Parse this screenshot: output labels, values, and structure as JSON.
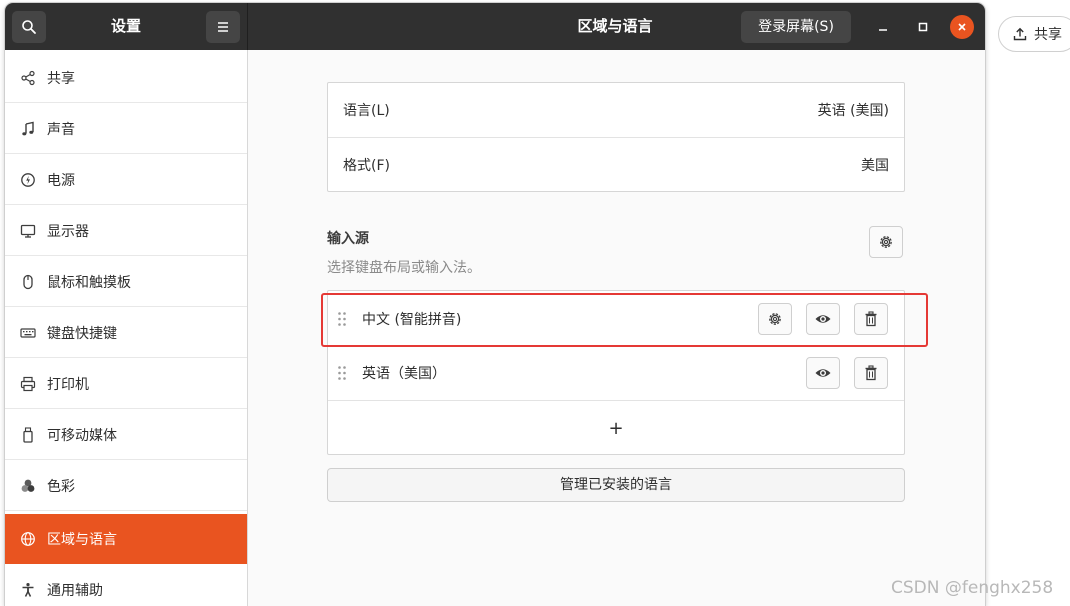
{
  "window": {
    "sidebar_title": "设置",
    "page_title": "区域与语言",
    "login_screen_label": "登录屏幕(S)"
  },
  "sidebar": {
    "items": [
      {
        "label": "共享",
        "icon": "share-icon"
      },
      {
        "label": "声音",
        "icon": "music-note-icon"
      },
      {
        "label": "电源",
        "icon": "power-icon"
      },
      {
        "label": "显示器",
        "icon": "display-icon"
      },
      {
        "label": "鼠标和触摸板",
        "icon": "mouse-icon"
      },
      {
        "label": "键盘快捷键",
        "icon": "keyboard-icon"
      },
      {
        "label": "打印机",
        "icon": "printer-icon"
      },
      {
        "label": "可移动媒体",
        "icon": "usb-drive-icon"
      },
      {
        "label": "色彩",
        "icon": "color-icon"
      },
      {
        "label": "区域与语言",
        "icon": "globe-icon",
        "active": true
      },
      {
        "label": "通用辅助",
        "icon": "accessibility-icon"
      }
    ]
  },
  "region": {
    "language_label": "语言(L)",
    "language_value": "英语 (美国)",
    "format_label": "格式(F)",
    "format_value": "美国"
  },
  "input_sources": {
    "title": "输入源",
    "subtitle": "选择键盘布局或输入法。",
    "sources": [
      {
        "label": "中文 (智能拼音)",
        "has_settings": true
      },
      {
        "label": "英语（美国）",
        "has_settings": false
      }
    ],
    "add_label": "+",
    "manage_label": "管理已安装的语言"
  },
  "external": {
    "share_label": "共享",
    "watermark": "CSDN @fenghx258"
  },
  "colors": {
    "accent": "#e95420",
    "headerbar": "#303030",
    "highlight_box": "#e53935"
  }
}
